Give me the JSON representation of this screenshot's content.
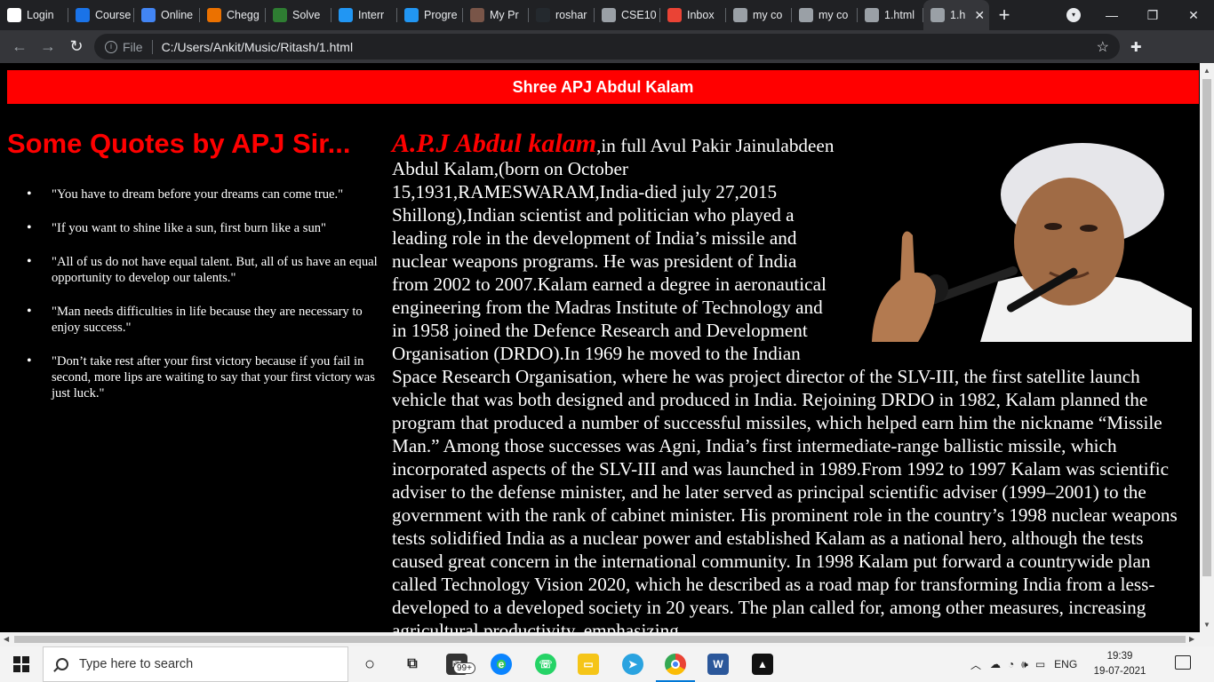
{
  "browser": {
    "tabs": [
      {
        "label": "Login",
        "icon": "circle-info-icon",
        "color": "#ffffff"
      },
      {
        "label": "Course",
        "icon": "coursera-icon",
        "color": "#1a73e8"
      },
      {
        "label": "Online",
        "icon": "online-icon",
        "color": "#4285f4"
      },
      {
        "label": "Chegg",
        "icon": "chegg-icon",
        "color": "#eb7100"
      },
      {
        "label": "Solve",
        "icon": "solve-icon",
        "color": "#2e7d32"
      },
      {
        "label": "Interr",
        "icon": "interviewbit-icon",
        "color": "#2196f3"
      },
      {
        "label": "Progre",
        "icon": "interviewbit-icon",
        "color": "#2196f3"
      },
      {
        "label": "My Pr",
        "icon": "profile-icon",
        "color": "#795548"
      },
      {
        "label": "roshar",
        "icon": "github-icon",
        "color": "#24292e"
      },
      {
        "label": "CSE10",
        "icon": "globe-icon",
        "color": "#9aa0a6"
      },
      {
        "label": "Inbox",
        "icon": "gmail-icon",
        "color": "#ea4335"
      },
      {
        "label": "my co",
        "icon": "globe-icon",
        "color": "#9aa0a6"
      },
      {
        "label": "my co",
        "icon": "globe-icon",
        "color": "#9aa0a6"
      },
      {
        "label": "1.html",
        "icon": "globe-icon",
        "color": "#9aa0a6"
      },
      {
        "label": "1.h",
        "icon": "globe-icon",
        "color": "#9aa0a6"
      }
    ],
    "new_tab_label": "+",
    "address": {
      "scheme": "File",
      "url": "C:/Users/Ankit/Music/Ritash/1.html"
    }
  },
  "page": {
    "banner_title": "Shree APJ Abdul Kalam",
    "quotes_heading": "Some Quotes by APJ Sir...",
    "quotes": [
      "\"You have to dream before your dreams can come true.\"",
      "\"If you want to shine like a sun, first burn like a sun\"",
      "\"All of us do not have equal talent. But, all of us have an equal opportunity to develop our talents.\"",
      "\"Man needs difficulties in life because they are necessary to enjoy success.\"",
      "\"Don’t take rest after your first victory because if you fail in second, more lips are waiting to say that your first victory was just luck.\""
    ],
    "bio_name": "A.P.J Abdul kalam",
    "bio_text": ",in full Avul Pakir Jainulabdeen Abdul Kalam,(born on October 15,1931,RAMESWARAM,India-died july 27,2015 Shillong),Indian scientist and politician who played a leading role in the development of India’s missile and nuclear weapons programs. He was president of India from 2002 to 2007.Kalam earned a degree in aeronautical engineering from the Madras Institute of Technology and in 1958 joined the Defence Research and Development Organisation (DRDO).In 1969 he moved to the Indian Space Research Organisation, where he was project director of the SLV-III, the first satellite launch vehicle that was both designed and produced in India. Rejoining DRDO in 1982, Kalam planned the program that produced a number of successful missiles, which helped earn him the nickname “Missile Man.” Among those successes was Agni, India’s first intermediate-range ballistic missile, which incorporated aspects of the SLV-III and was launched in 1989.From 1992 to 1997 Kalam was scientific adviser to the defense minister, and he later served as principal scientific adviser (1999–2001) to the government with the rank of cabinet minister. His prominent role in the country’s 1998 nuclear weapons tests solidified India as a nuclear power and established Kalam as a national hero, although the tests caused great concern in the international community. In 1998 Kalam put forward a countrywide plan called Technology Vision 2020, which he described as a road map for transforming India from a less-developed to a developed society in 20 years. The plan called for, among other measures, increasing agricultural productivity, emphasizing"
  },
  "taskbar": {
    "search_placeholder": "Type here to search",
    "mail_badge": "99+",
    "language": "ENG",
    "time": "19:39",
    "date": "19-07-2021"
  },
  "colors": {
    "banner": "#ff0000",
    "accent_red": "#ff0000",
    "page_bg": "#000000",
    "chrome_dark": "#202124",
    "chrome_toolbar": "#35363a"
  }
}
